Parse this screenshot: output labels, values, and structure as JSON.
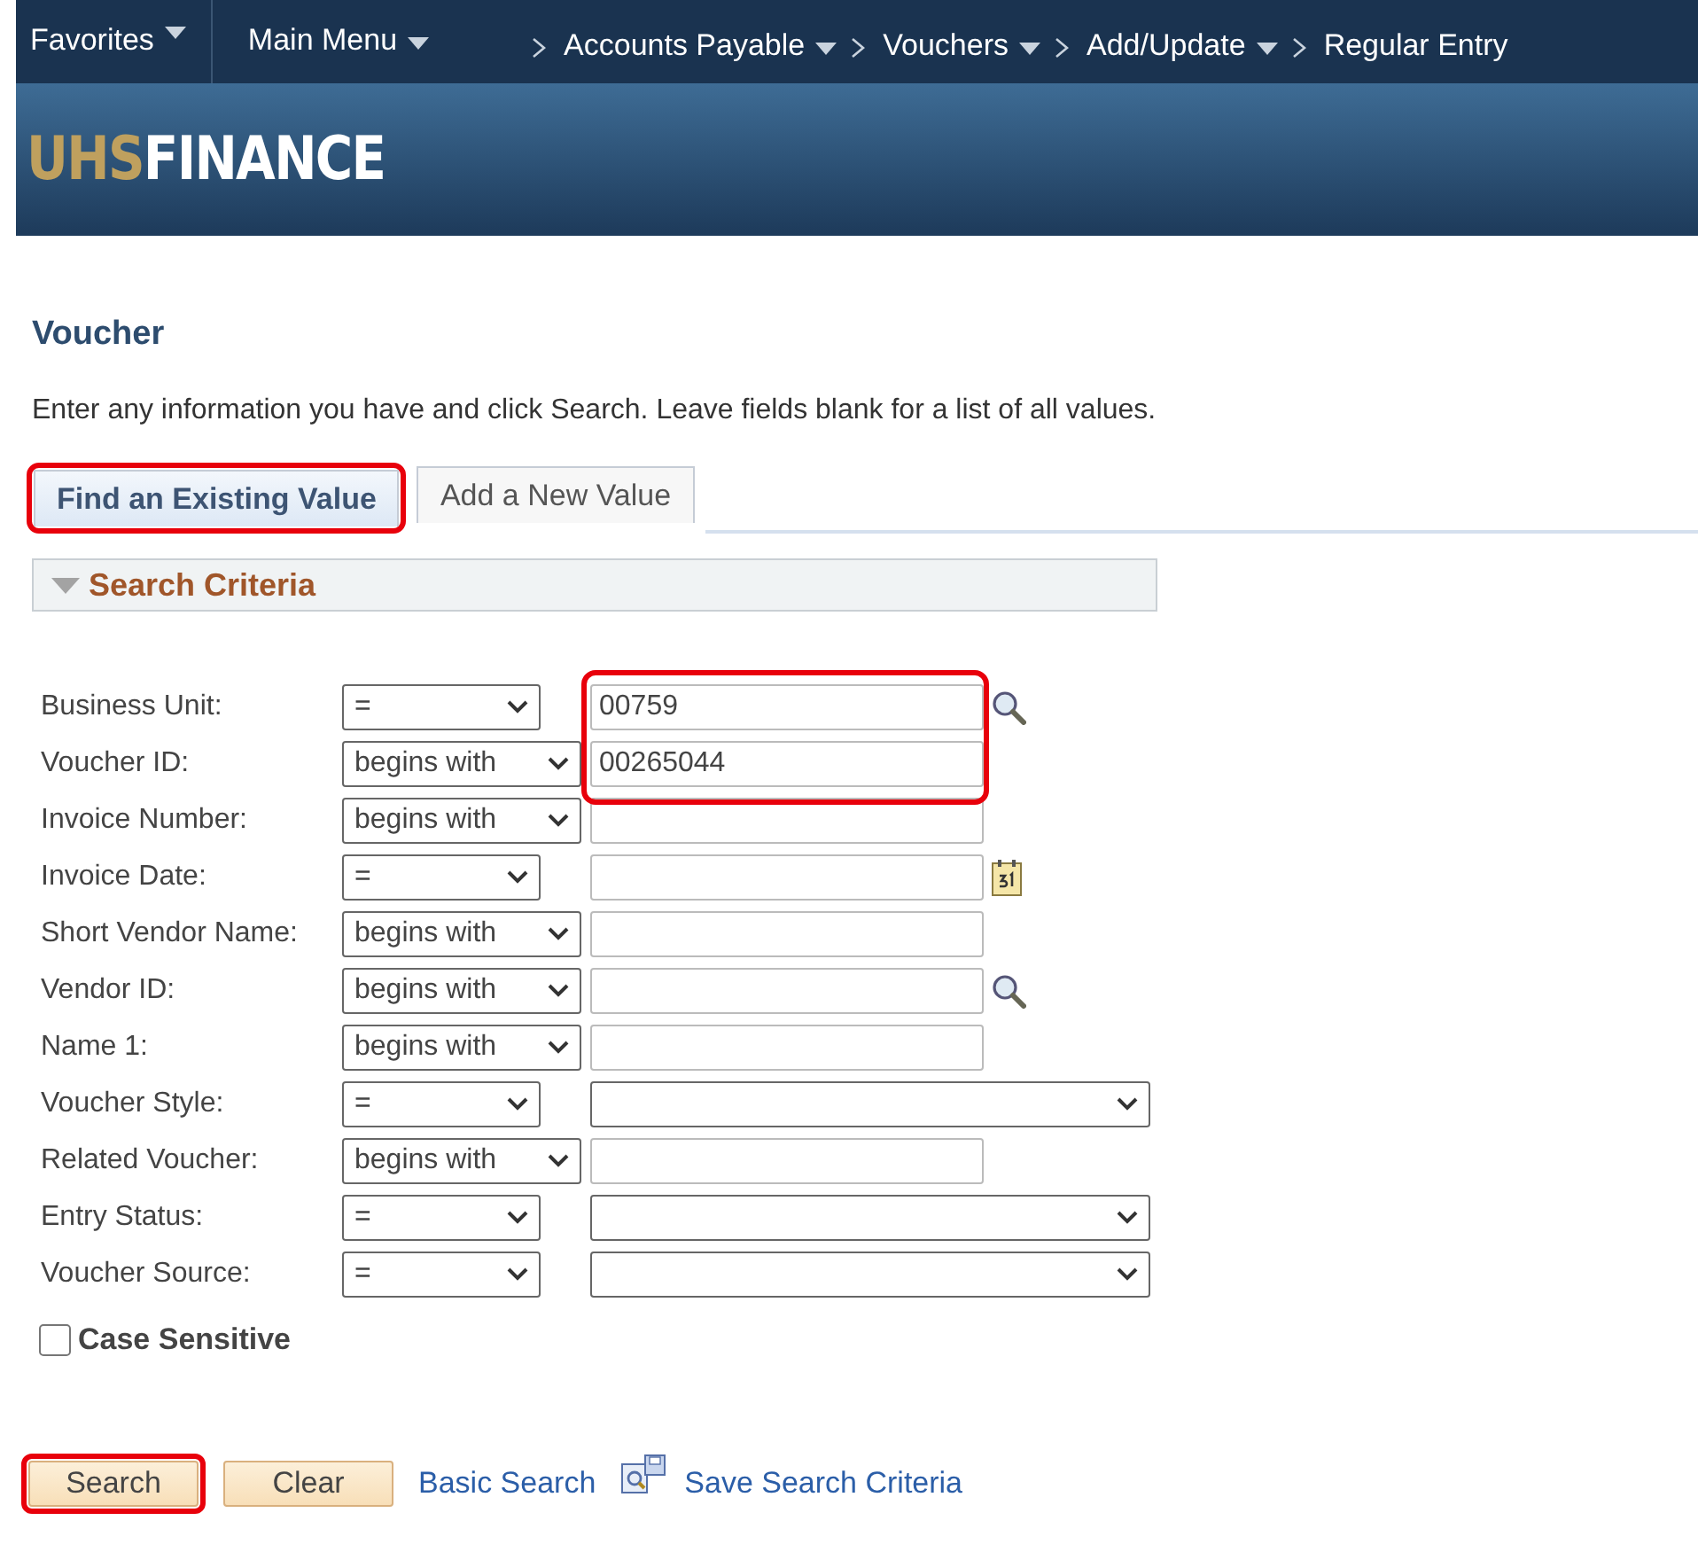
{
  "nav": {
    "menus": [
      {
        "label": "Favorites"
      },
      {
        "label": "Main Menu"
      }
    ],
    "breadcrumbs": [
      {
        "label": "Accounts Payable"
      },
      {
        "label": "Vouchers"
      },
      {
        "label": "Add/Update"
      },
      {
        "label": "Regular Entry"
      }
    ]
  },
  "banner": {
    "logo_part_1": "UHS",
    "logo_part_2": "FINANCE"
  },
  "page": {
    "title": "Voucher",
    "instructions": "Enter any information you have and click Search. Leave fields blank for a list of all values."
  },
  "tabs": [
    {
      "label": "Find an Existing Value",
      "selected": true,
      "highlighted": true
    },
    {
      "label": "Add a New Value",
      "selected": false,
      "highlighted": false
    }
  ],
  "section": {
    "title": "Search Criteria",
    "expanded": true
  },
  "fields": [
    {
      "label": "Business Unit:",
      "operator": "=",
      "kind": "lookup",
      "value": "00759",
      "highlighted": true
    },
    {
      "label": "Voucher ID:",
      "operator": "begins with",
      "kind": "text",
      "value": "00265044",
      "highlighted": true
    },
    {
      "label": "Invoice Number:",
      "operator": "begins with",
      "kind": "text",
      "highlighted": false
    },
    {
      "label": "Invoice Date:",
      "operator": "=",
      "kind": "date",
      "highlighted": false
    },
    {
      "label": "Short Vendor Name:",
      "operator": "begins with",
      "kind": "text",
      "highlighted": false
    },
    {
      "label": "Vendor ID:",
      "operator": "begins with",
      "kind": "lookup",
      "highlighted": false
    },
    {
      "label": "Name 1:",
      "operator": "begins with",
      "kind": "text",
      "highlighted": false
    },
    {
      "label": "Voucher Style:",
      "operator": "=",
      "kind": "dropdown",
      "highlighted": false
    },
    {
      "label": "Related Voucher:",
      "operator": "begins with",
      "kind": "text",
      "highlighted": false
    },
    {
      "label": "Entry Status:",
      "operator": "=",
      "kind": "dropdown",
      "highlighted": false
    },
    {
      "label": "Voucher Source:",
      "operator": "=",
      "kind": "dropdown",
      "highlighted": false
    }
  ],
  "case_sensitive": {
    "label": "Case Sensitive",
    "checked": false
  },
  "buttons": [
    {
      "label": "Search",
      "highlighted": true
    },
    {
      "label": "Clear",
      "highlighted": false
    }
  ],
  "links": [
    {
      "label": "Basic Search"
    },
    {
      "label": "Save Search Criteria"
    }
  ]
}
